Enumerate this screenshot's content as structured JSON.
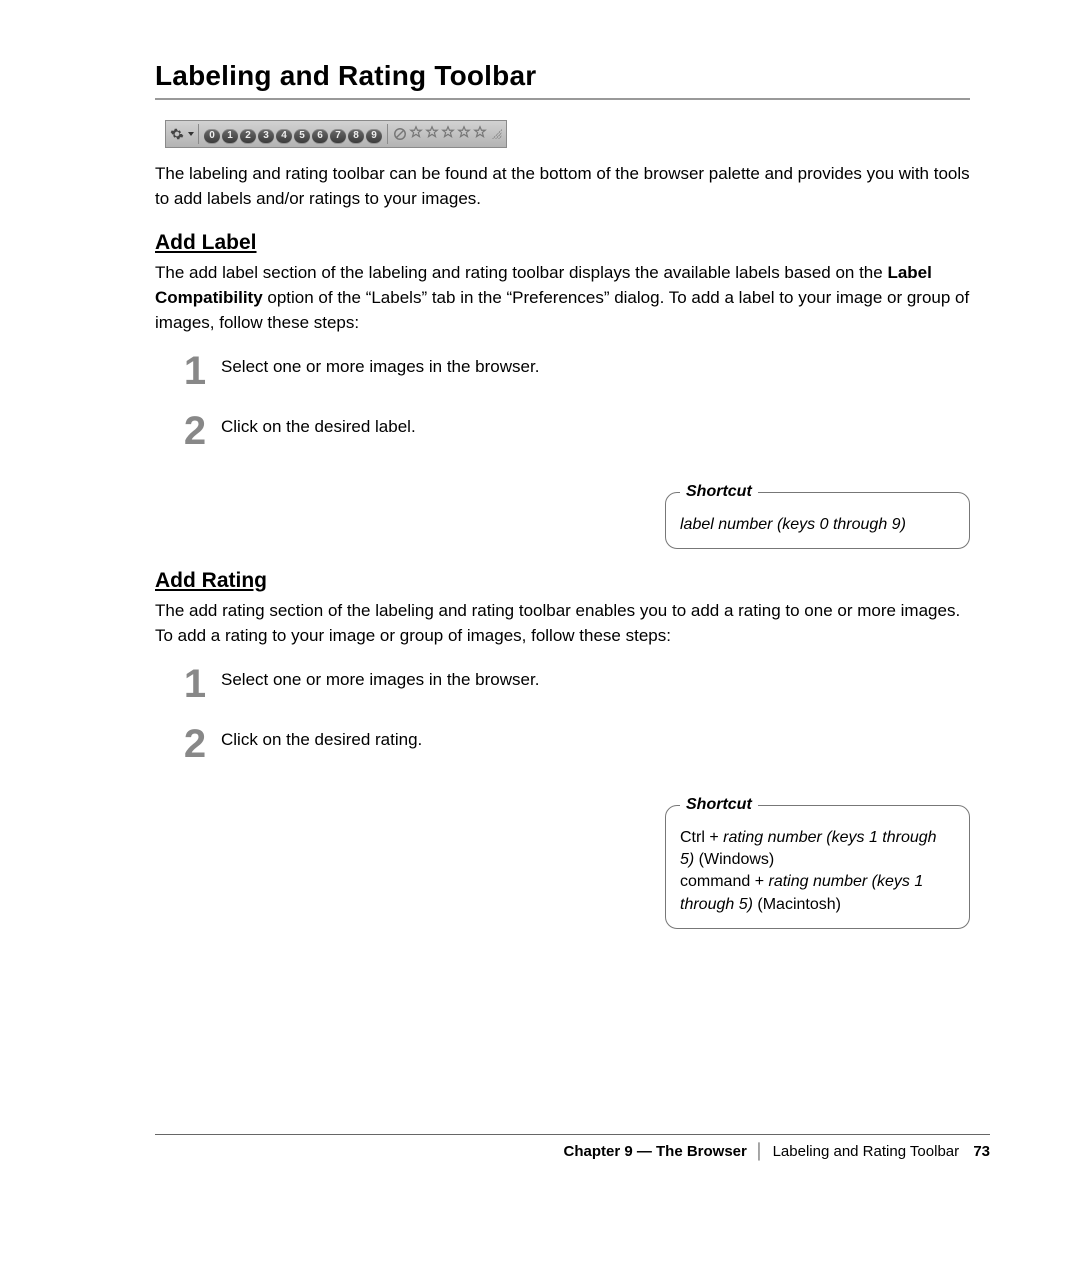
{
  "title": "Labeling and Rating Toolbar",
  "intro": "The labeling and rating toolbar can be found at the bottom of the browser palette and provides you with tools to add labels and/or ratings to your images.",
  "toolbar": {
    "gear_icon": "gear",
    "labels": [
      "0",
      "1",
      "2",
      "3",
      "4",
      "5",
      "6",
      "7",
      "8",
      "9"
    ],
    "rating_clear_icon": "prohibit",
    "stars": 5,
    "resize_icon": "resize-grip"
  },
  "sections": {
    "add_label": {
      "heading": "Add Label",
      "para_parts": [
        "The add label section of the labeling and rating toolbar displays the available labels based on the ",
        "Label Compatibility",
        " option of the “Labels” tab in the “Preferences” dialog. To add a label to your image or group of images, follow these steps:"
      ],
      "steps": [
        "Select one or more images in the browser.",
        "Click on the desired label."
      ],
      "shortcut": {
        "legend": "Shortcut",
        "text": "label number (keys 0 through 9)"
      }
    },
    "add_rating": {
      "heading": "Add Rating",
      "para": "The add rating section of the labeling and rating toolbar enables you to add a rating to one or more images. To add a rating to your image or group of images, follow these steps:",
      "steps": [
        "Select one or more images in the browser.",
        "Click on the desired rating."
      ],
      "shortcut": {
        "legend": "Shortcut",
        "lines": [
          {
            "prefix": "Ctrl + ",
            "ital": "rating number (keys 1 through 5)",
            "suffix": " (Windows)"
          },
          {
            "prefix": "command + ",
            "ital": "rating number (keys 1 through 5)",
            "suffix": " (Macintosh)"
          }
        ]
      }
    }
  },
  "footer": {
    "chapter": "Chapter 9 — The Browser",
    "section": "Labeling and Rating Toolbar",
    "page": "73"
  }
}
